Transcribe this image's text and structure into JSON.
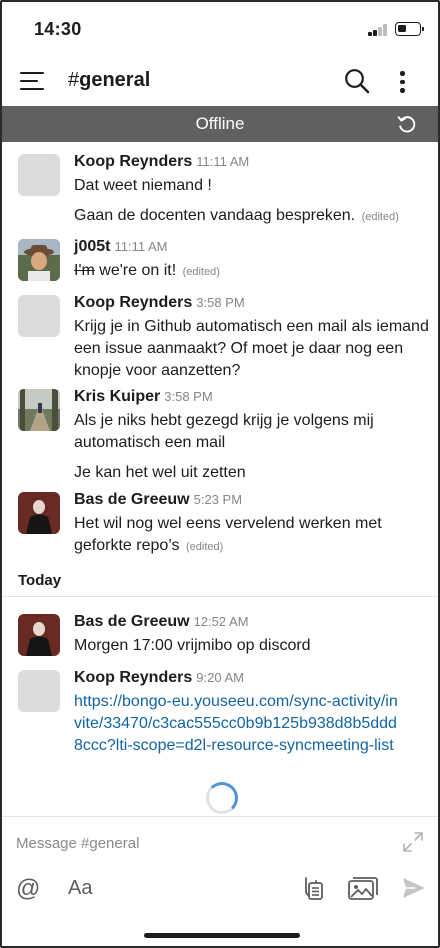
{
  "status_bar": {
    "time": "14:30"
  },
  "header": {
    "hash": "#",
    "channel": "general"
  },
  "banner": {
    "text": "Offline"
  },
  "messages": [
    {
      "author": "Koop Reynders",
      "time": "11:11 AM",
      "lines": [
        "Dat weet niemand !",
        "Gaan de docenten vandaag bespreken."
      ],
      "edited": "(edited)"
    },
    {
      "author": "j005t",
      "time": "11:11 AM",
      "struck": "I'm",
      "text": " we're on it!",
      "edited": "(edited)"
    },
    {
      "author": "Koop Reynders",
      "time": "3:58 PM",
      "text": "Krijg je in Github automatisch een mail als iemand een issue aanmaakt? Of moet je daar nog een knopje voor aanzetten?"
    },
    {
      "author": "Kris Kuiper",
      "time": "3:58 PM",
      "lines": [
        "Als je niks hebt gezegd krijg je volgens mij automatisch een mail",
        "Je kan het wel uit zetten"
      ]
    },
    {
      "author": "Bas de Greeuw",
      "time": "5:23 PM",
      "text": "Het wil nog wel eens vervelend werken met geforkte repo’s",
      "edited": "(edited)"
    }
  ],
  "divider": {
    "label": "Today"
  },
  "today_messages": [
    {
      "author": "Bas de Greeuw",
      "time": "12:52 AM",
      "text": "Morgen 17:00 vrijmibo op discord"
    },
    {
      "author": "Koop Reynders",
      "time": "9:20 AM",
      "link": "https://bongo-eu.youseeu.com/sync-activity/invite/33470/c3cac555cc0b9b125b938d8b5ddd8ccc?lti-scope=d2l-resource-syncmeeting-list"
    }
  ],
  "composer": {
    "placeholder": "Message #general",
    "format_label": "Aa"
  },
  "colors": {
    "offline_banner": "#616061",
    "link": "#1264a3",
    "spinner": "#4f94d4"
  },
  "icons": [
    "menu-icon",
    "search-icon",
    "more-icon",
    "reload-icon",
    "expand-icon",
    "at-icon",
    "shortcut-icon",
    "image-icon",
    "send-icon"
  ]
}
